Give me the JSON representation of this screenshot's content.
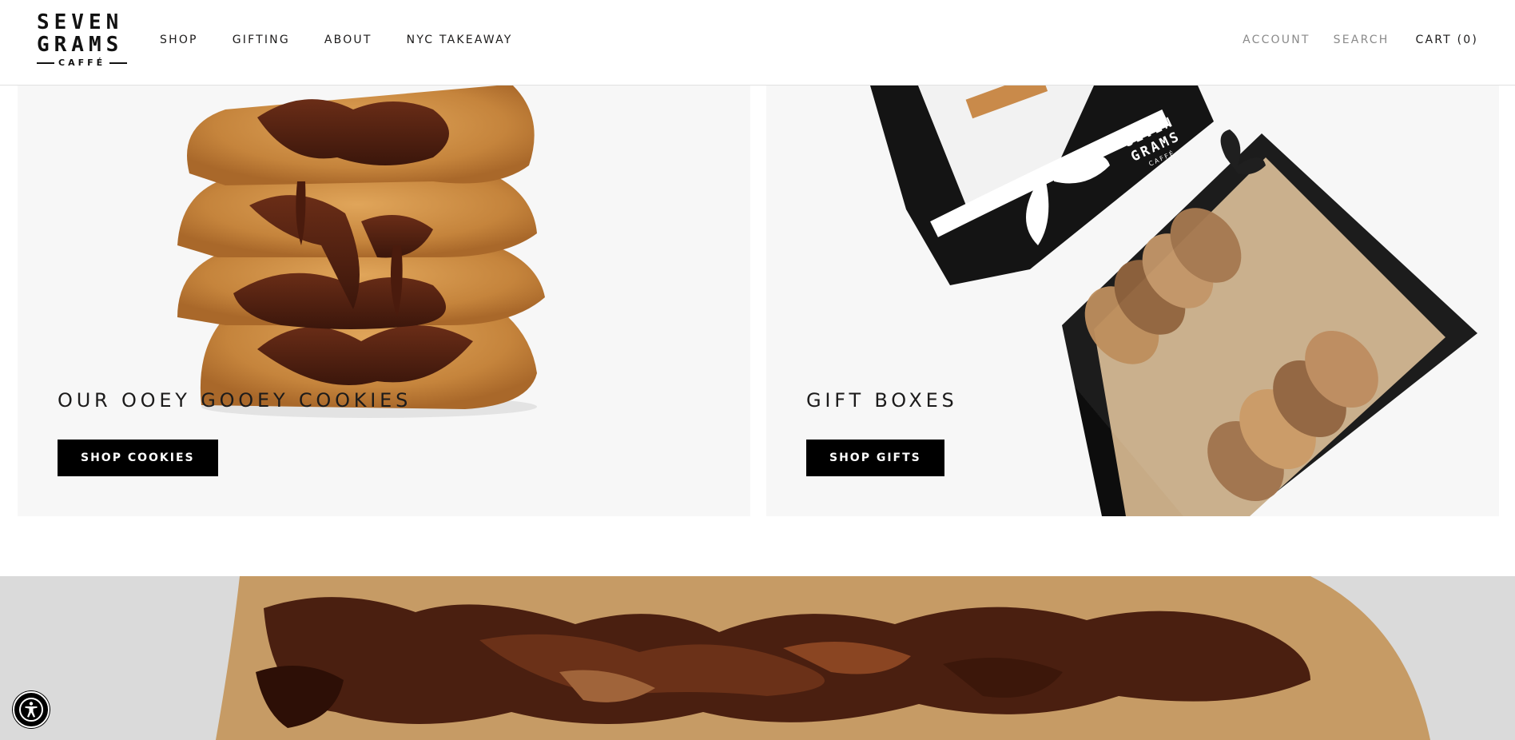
{
  "brand": {
    "line1": "SEVEN",
    "line2": "GRAMS",
    "line3": "CAFFÉ"
  },
  "nav": {
    "shop": "SHOP",
    "gifting": "GIFTING",
    "about": "ABOUT",
    "nyc_takeaway": "NYC TAKEAWAY"
  },
  "utility": {
    "account": "ACCOUNT",
    "search": "SEARCH",
    "cart": "CART (0)"
  },
  "cards": {
    "cookies": {
      "title": "OUR OOEY GOOEY COOKIES",
      "button": "SHOP COOKIES"
    },
    "gifts": {
      "title": "GIFT BOXES",
      "button": "SHOP GIFTS"
    }
  },
  "gift_box_print": {
    "line1": "SEVEN",
    "line2": "GRAMS",
    "line3": "CAFFÉ"
  },
  "colors": {
    "text": "#1c1b1b",
    "muted": "#8a8a8a",
    "button_bg": "#000000",
    "button_text": "#ffffff",
    "card_bg": "#f7f7f7"
  },
  "icons": {
    "accessibility": "accessibility-icon"
  }
}
